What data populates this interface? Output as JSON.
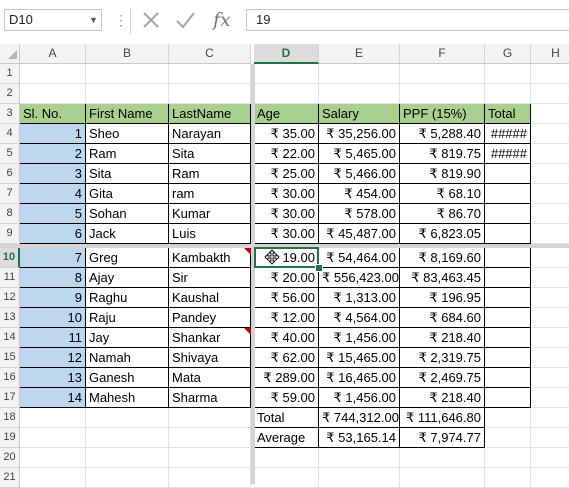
{
  "formula_bar": {
    "name_box": "D10",
    "formula": "19",
    "fx_label": "fx",
    "cancel_icon": "cancel-x-icon",
    "enter_icon": "enter-check-icon"
  },
  "columns": [
    "A",
    "B",
    "C",
    "D",
    "E",
    "F",
    "G",
    "H"
  ],
  "active_column": "D",
  "active_row": 10,
  "rows": [
    1,
    2,
    3,
    4,
    5,
    6,
    7,
    8,
    9,
    10,
    11,
    12,
    13,
    14,
    15,
    16,
    17,
    18,
    19,
    20,
    21
  ],
  "table": {
    "headers": [
      "Sl. No.",
      "First Name",
      "LastName",
      "Age",
      "Salary",
      "PPF (15%)",
      "Total"
    ],
    "records": [
      [
        "1",
        "Sheo",
        "Narayan",
        "₹ 35.00",
        "₹ 35,256.00",
        "₹ 5,288.40",
        "#####"
      ],
      [
        "2",
        "Ram",
        "Sita",
        "₹ 22.00",
        "₹ 5,465.00",
        "₹ 819.75",
        "#####"
      ],
      [
        "3",
        "Sita",
        "Ram",
        "₹ 25.00",
        "₹ 5,466.00",
        "₹ 819.90",
        ""
      ],
      [
        "4",
        "Gita",
        "ram",
        "₹ 30.00",
        "₹ 454.00",
        "₹ 68.10",
        ""
      ],
      [
        "5",
        "Sohan",
        "Kumar",
        "₹ 30.00",
        "₹ 578.00",
        "₹ 86.70",
        ""
      ],
      [
        "6",
        "Jack",
        "Luis",
        "₹ 30.00",
        "₹ 45,487.00",
        "₹ 6,823.05",
        ""
      ],
      [
        "7",
        "Greg",
        "Kambakth",
        "19.00",
        "₹ 54,464.00",
        "₹ 8,169.60",
        ""
      ],
      [
        "8",
        "Ajay",
        "Sir",
        "₹ 20.00",
        "₹ 556,423.00",
        "₹ 83,463.45",
        ""
      ],
      [
        "9",
        "Raghu",
        "Kaushal",
        "₹ 56.00",
        "₹ 1,313.00",
        "₹ 196.95",
        ""
      ],
      [
        "10",
        "Raju",
        "Pandey",
        "₹ 12.00",
        "₹ 4,564.00",
        "₹ 684.60",
        ""
      ],
      [
        "11",
        "Jay",
        "Shankar",
        "₹ 40.00",
        "₹ 1,456.00",
        "₹ 218.40",
        ""
      ],
      [
        "12",
        "Namah",
        "Shivaya",
        "₹ 62.00",
        "₹ 15,465.00",
        "₹ 2,319.75",
        ""
      ],
      [
        "13",
        "Ganesh",
        "Mata",
        "₹ 289.00",
        "₹ 16,465.00",
        "₹ 2,469.75",
        ""
      ],
      [
        "14",
        "Mahesh",
        "Sharma",
        "₹ 59.00",
        "₹ 1,456.00",
        "₹ 218.40",
        ""
      ]
    ],
    "summary": [
      {
        "label": "Total",
        "salary": "₹ 744,312.00",
        "ppf": "₹ 111,646.80"
      },
      {
        "label": "Average",
        "salary": "₹ 53,165.14",
        "ppf": "₹ 7,974.77"
      }
    ]
  },
  "colors": {
    "header_fill": "#a9d08e",
    "serial_fill": "#bdd7ee",
    "accent": "#217346",
    "comment": "#c00000"
  }
}
